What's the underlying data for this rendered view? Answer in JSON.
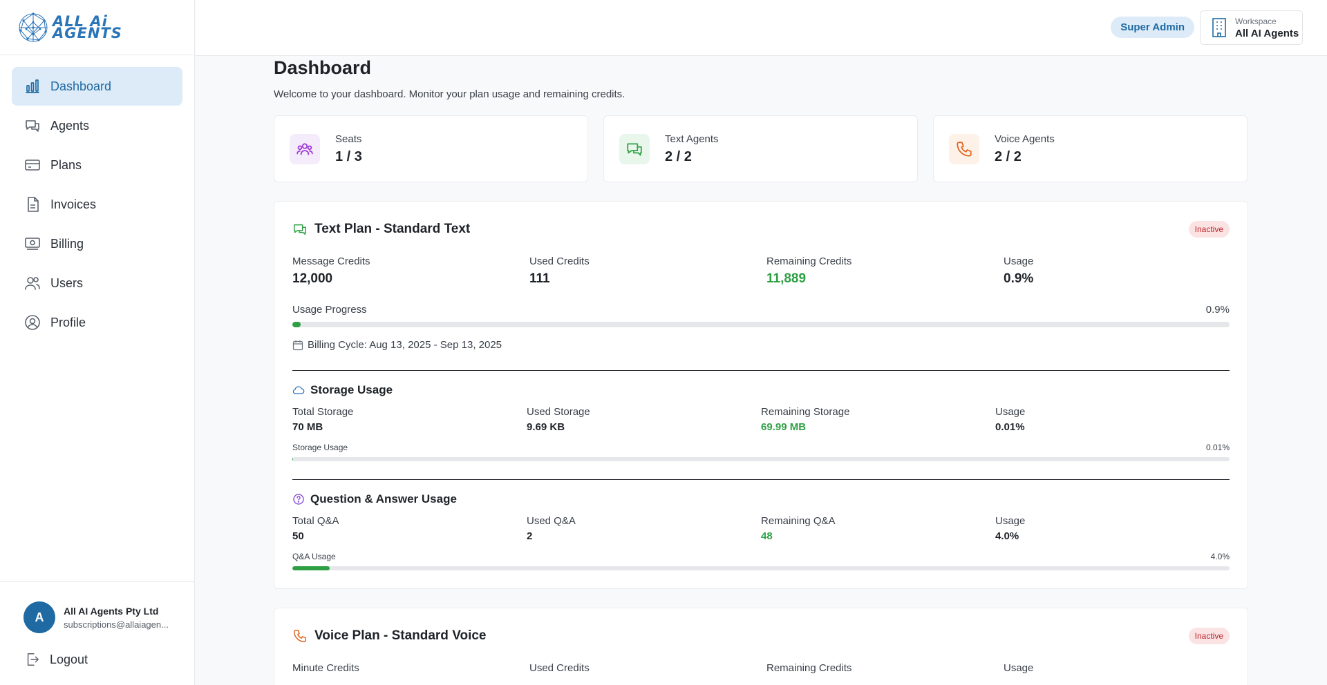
{
  "brand": {
    "logo_line1": "ALL Ai",
    "logo_line2": "AGENTS"
  },
  "colors": {
    "accent": "#1f6aa3",
    "accent_bg": "#dcebf7",
    "green": "#2ea043",
    "inactive_bg": "#fbe3e3",
    "inactive_text": "#c0262d"
  },
  "sidebar": {
    "items": [
      {
        "label": "Dashboard",
        "icon": "bar-chart-icon",
        "active": true
      },
      {
        "label": "Agents",
        "icon": "chat-bubbles-icon"
      },
      {
        "label": "Plans",
        "icon": "credit-card-icon"
      },
      {
        "label": "Invoices",
        "icon": "document-icon"
      },
      {
        "label": "Billing",
        "icon": "banknote-icon"
      },
      {
        "label": "Users",
        "icon": "users-icon"
      },
      {
        "label": "Profile",
        "icon": "user-circle-icon"
      }
    ],
    "user": {
      "initial": "A",
      "name": "All AI Agents Pty Ltd",
      "email": "subscriptions@allaiagen..."
    },
    "logout_label": "Logout"
  },
  "topbar": {
    "role_badge": "Super Admin",
    "workspace_label": "Workspace",
    "workspace_name": "All AI Agents"
  },
  "page": {
    "title": "Dashboard",
    "subtitle": "Welcome to your dashboard. Monitor your plan usage and remaining credits."
  },
  "stats": [
    {
      "label": "Seats",
      "value": "1 / 3",
      "icon": "users-icon"
    },
    {
      "label": "Text Agents",
      "value": "2 / 2",
      "icon": "chat-bubbles-icon"
    },
    {
      "label": "Voice Agents",
      "value": "2 / 2",
      "icon": "phone-icon"
    }
  ],
  "text_plan": {
    "title": "Text Plan - Standard Text",
    "status": "Inactive",
    "metrics": [
      {
        "label": "Message Credits",
        "value": "12,000"
      },
      {
        "label": "Used Credits",
        "value": "111"
      },
      {
        "label": "Remaining Credits",
        "value": "11,889"
      },
      {
        "label": "Usage",
        "value": "0.9%"
      }
    ],
    "progress_label": "Usage Progress",
    "progress_text": "0.9%",
    "progress_fraction": 0.009,
    "billing_cycle": "Billing Cycle: Aug 13, 2025 - Sep 13, 2025",
    "storage": {
      "title": "Storage Usage",
      "metrics": [
        {
          "label": "Total Storage",
          "value": "70 MB"
        },
        {
          "label": "Used Storage",
          "value": "9.69 KB"
        },
        {
          "label": "Remaining Storage",
          "value": "69.99 MB"
        },
        {
          "label": "Usage",
          "value": "0.01%"
        }
      ],
      "progress_label": "Storage Usage",
      "progress_text": "0.01%",
      "progress_fraction": 0.0001
    },
    "qa": {
      "title": "Question & Answer Usage",
      "metrics": [
        {
          "label": "Total Q&A",
          "value": "50"
        },
        {
          "label": "Used Q&A",
          "value": "2"
        },
        {
          "label": "Remaining Q&A",
          "value": "48"
        },
        {
          "label": "Usage",
          "value": "4.0%"
        }
      ],
      "progress_label": "Q&A Usage",
      "progress_text": "4.0%",
      "progress_fraction": 0.04
    }
  },
  "voice_plan": {
    "title": "Voice Plan - Standard Voice",
    "status": "Inactive",
    "metrics": [
      {
        "label": "Minute Credits"
      },
      {
        "label": "Used Credits"
      },
      {
        "label": "Remaining Credits"
      },
      {
        "label": "Usage"
      }
    ]
  }
}
